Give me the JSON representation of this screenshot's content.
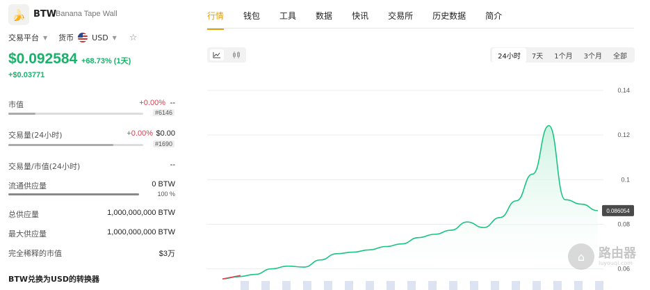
{
  "coin": {
    "symbol": "BTW",
    "name": "Banana Tape Wall",
    "logo_icon": "banana-tape-icon"
  },
  "platform": {
    "label": "交易平台",
    "currency_label": "货币",
    "currency": "USD"
  },
  "price": {
    "value": "$0.092584",
    "change_pct": "+68.73% (1天)",
    "change_abs": "+$0.03771"
  },
  "stats": [
    {
      "label": "市值",
      "pct": "+0.00%",
      "value": "--",
      "rank": "#6146",
      "bar": 0.2
    },
    {
      "label": "交易量(24小时)",
      "pct": "+0.00%",
      "value": "$0.00",
      "rank": "#1690",
      "bar": 0.78
    },
    {
      "label": "交易量/市值(24小时)",
      "value": "--"
    },
    {
      "label": "流通供应量",
      "value": "0 BTW",
      "sub": "100 %",
      "bar": 1.0
    },
    {
      "label": "总供应量",
      "value": "1,000,000,000 BTW"
    },
    {
      "label": "最大供应量",
      "value": "1,000,000,000 BTW"
    },
    {
      "label": "完全稀释的市值",
      "value": "$3万"
    }
  ],
  "converter_title": "BTW兑换为USD的转换器",
  "tabs": [
    "行情",
    "钱包",
    "工具",
    "数据",
    "快讯",
    "交易所",
    "历史数据",
    "简介"
  ],
  "active_tab": 0,
  "ranges": [
    "24小时",
    "7天",
    "1个月",
    "3个月",
    "全部"
  ],
  "active_range": 0,
  "chart_data": {
    "type": "area",
    "y_ticks": [
      "0.14",
      "0.12",
      "0.1",
      "0.08",
      "0.06"
    ],
    "ylim": [
      0.058,
      0.14
    ],
    "current_value_label": "0.086054",
    "series": [
      {
        "values": [
          0.0555,
          0.0565,
          0.0575,
          0.06,
          0.0612,
          0.0608,
          0.064,
          0.0668,
          0.0675,
          0.0685,
          0.07,
          0.0712,
          0.074,
          0.0755,
          0.0773,
          0.081,
          0.0785,
          0.083,
          0.0905,
          0.1025,
          0.1242,
          0.091,
          0.089,
          0.0861
        ]
      }
    ],
    "colors": {
      "line": "#18c483",
      "fill_top": "#c9f2df",
      "negative": "#e0394a"
    },
    "grid": true
  },
  "watermark": {
    "main": "路由器",
    "sub": "luyouqi.com"
  }
}
